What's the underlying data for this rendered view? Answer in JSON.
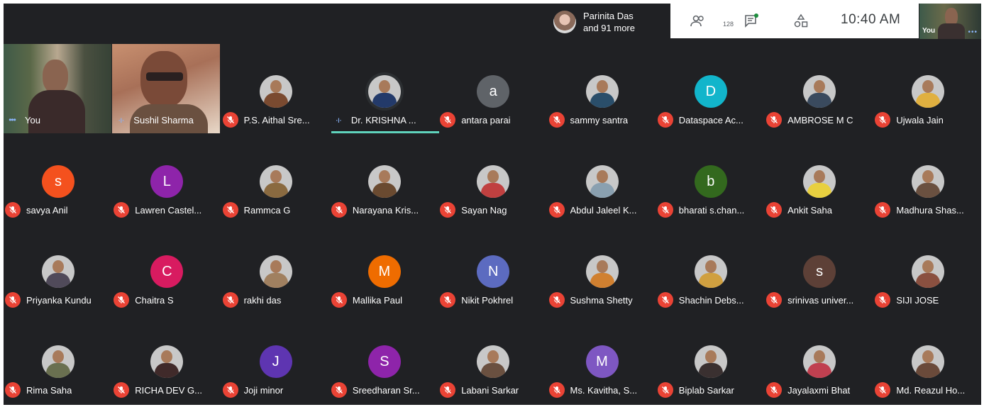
{
  "topbar": {
    "presence_line1": "Parinita Das",
    "presence_line2": "and 91 more",
    "people_count": "128",
    "clock": "10:40 AM",
    "self_label": "You"
  },
  "participants": [
    {
      "name": "You",
      "type": "video",
      "muted": false
    },
    {
      "name": "Sushil Sharma",
      "type": "video",
      "muted": false
    },
    {
      "name": "P.S. Aithal Sre...",
      "type": "photo",
      "color": "#7a4a30",
      "muted": true
    },
    {
      "name": "Dr. KRISHNA ...",
      "type": "photo",
      "color": "#233a6a",
      "muted": false,
      "speaking": true
    },
    {
      "name": "antara parai",
      "type": "letter",
      "letter": "a",
      "color": "#5f6368",
      "muted": true
    },
    {
      "name": "sammy santra",
      "type": "photo",
      "color": "#2a4e6a",
      "muted": true
    },
    {
      "name": "Dataspace Ac...",
      "type": "letter",
      "letter": "D",
      "color": "#12b5cb",
      "muted": true
    },
    {
      "name": "AMBROSE M C",
      "type": "photo",
      "color": "#3a4a5e",
      "muted": true
    },
    {
      "name": "Ujwala Jain",
      "type": "photo",
      "color": "#e0b040",
      "muted": true
    },
    {
      "name": "savya Anil",
      "type": "letter",
      "letter": "s",
      "color": "#f4511e",
      "muted": true
    },
    {
      "name": "Lawren Castel...",
      "type": "letter",
      "letter": "L",
      "color": "#8e24aa",
      "muted": true
    },
    {
      "name": "Rammca G",
      "type": "photo",
      "color": "#8a6a40",
      "muted": true
    },
    {
      "name": "Narayana Kris...",
      "type": "photo",
      "color": "#6a4a30",
      "muted": true
    },
    {
      "name": "Sayan Nag",
      "type": "photo",
      "color": "#c04040",
      "muted": true
    },
    {
      "name": "Abdul Jaleel K...",
      "type": "photo",
      "color": "#8aa0b0",
      "muted": true
    },
    {
      "name": "bharati s.chan...",
      "type": "letter",
      "letter": "b",
      "color": "#33691e",
      "muted": true
    },
    {
      "name": "Ankit Saha",
      "type": "photo",
      "color": "#e8d040",
      "muted": true
    },
    {
      "name": "Madhura Shas...",
      "type": "photo",
      "color": "#6a5040",
      "muted": true
    },
    {
      "name": "Priyanka Kundu",
      "type": "photo",
      "color": "#504a5a",
      "muted": true
    },
    {
      "name": "Chaitra S",
      "type": "letter",
      "letter": "C",
      "color": "#d81b60",
      "muted": true
    },
    {
      "name": "rakhi das",
      "type": "photo",
      "color": "#a08060",
      "muted": true
    },
    {
      "name": "Mallika Paul",
      "type": "letter",
      "letter": "M",
      "color": "#ef6c00",
      "muted": true
    },
    {
      "name": "Nikit Pokhrel",
      "type": "letter",
      "letter": "N",
      "color": "#5c6bc0",
      "muted": true
    },
    {
      "name": "Sushma Shetty",
      "type": "photo",
      "color": "#d08030",
      "muted": true
    },
    {
      "name": "Shachin Debs...",
      "type": "photo",
      "color": "#d0a040",
      "muted": true
    },
    {
      "name": "srinivas univer...",
      "type": "letter",
      "letter": "s",
      "color": "#5d4037",
      "muted": true
    },
    {
      "name": "SIJI JOSE",
      "type": "photo",
      "color": "#8a5040",
      "muted": true
    },
    {
      "name": "Rima Saha",
      "type": "photo",
      "color": "#6a7050",
      "muted": true
    },
    {
      "name": "RICHA DEV G...",
      "type": "photo",
      "color": "#402a2a",
      "muted": true
    },
    {
      "name": "Joji minor",
      "type": "letter",
      "letter": "J",
      "color": "#5e35b1",
      "muted": true
    },
    {
      "name": "Sreedharan Sr...",
      "type": "letter",
      "letter": "S",
      "color": "#8e24aa",
      "muted": true
    },
    {
      "name": "Labani Sarkar",
      "type": "photo",
      "color": "#6a5040",
      "muted": true
    },
    {
      "name": "Ms. Kavitha, S...",
      "type": "letter",
      "letter": "M",
      "color": "#7e57c2",
      "muted": true
    },
    {
      "name": "Biplab Sarkar",
      "type": "photo",
      "color": "#3a3030",
      "muted": true
    },
    {
      "name": "Jayalaxmi Bhat",
      "type": "photo",
      "color": "#c04050",
      "muted": true
    },
    {
      "name": "Md. Reazul Ho...",
      "type": "photo",
      "color": "#6a4a3a",
      "muted": true
    }
  ]
}
